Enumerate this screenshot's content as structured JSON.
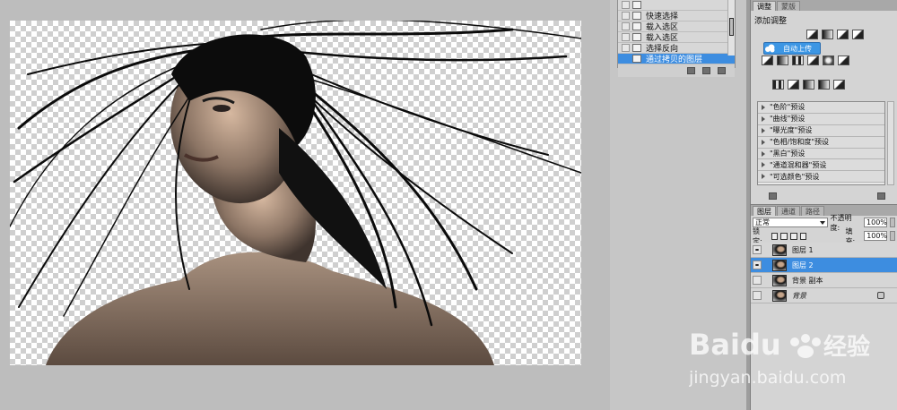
{
  "history": {
    "items": [
      {
        "label": "",
        "active": false
      },
      {
        "label": "快速选择",
        "active": false
      },
      {
        "label": "载入选区",
        "active": false
      },
      {
        "label": "载入选区",
        "active": false
      },
      {
        "label": "选择反向",
        "active": false
      },
      {
        "label": "通过拷贝的图层",
        "active": true
      }
    ]
  },
  "adjustments": {
    "tabs": [
      "调整",
      "蒙版"
    ],
    "title": "添加调整",
    "tooltip": "自动上传",
    "presets": [
      "\"色阶\"预设",
      "\"曲线\"预设",
      "\"曝光度\"预设",
      "\"色相/饱和度\"预设",
      "\"黑白\"预设",
      "\"通道混和器\"预设",
      "\"可选颜色\"预设"
    ]
  },
  "layers": {
    "tabs": [
      "图层",
      "通道",
      "路径"
    ],
    "blend_mode": "正常",
    "opacity_label": "不透明度:",
    "opacity_value": "100%",
    "lock_label": "锁定:",
    "fill_label": "填充:",
    "fill_value": "100%",
    "items": [
      {
        "name": "图层 1",
        "visible": true,
        "selected": false,
        "italic": false,
        "locked": false
      },
      {
        "name": "图层 2",
        "visible": true,
        "selected": true,
        "italic": false,
        "locked": false
      },
      {
        "name": "背景 副本",
        "visible": false,
        "selected": false,
        "italic": false,
        "locked": false
      },
      {
        "name": "背景",
        "visible": false,
        "selected": false,
        "italic": true,
        "locked": true
      }
    ]
  },
  "watermark": {
    "brand": "Baidu",
    "brand_cn": "经验",
    "url": "jingyan.baidu.com"
  }
}
